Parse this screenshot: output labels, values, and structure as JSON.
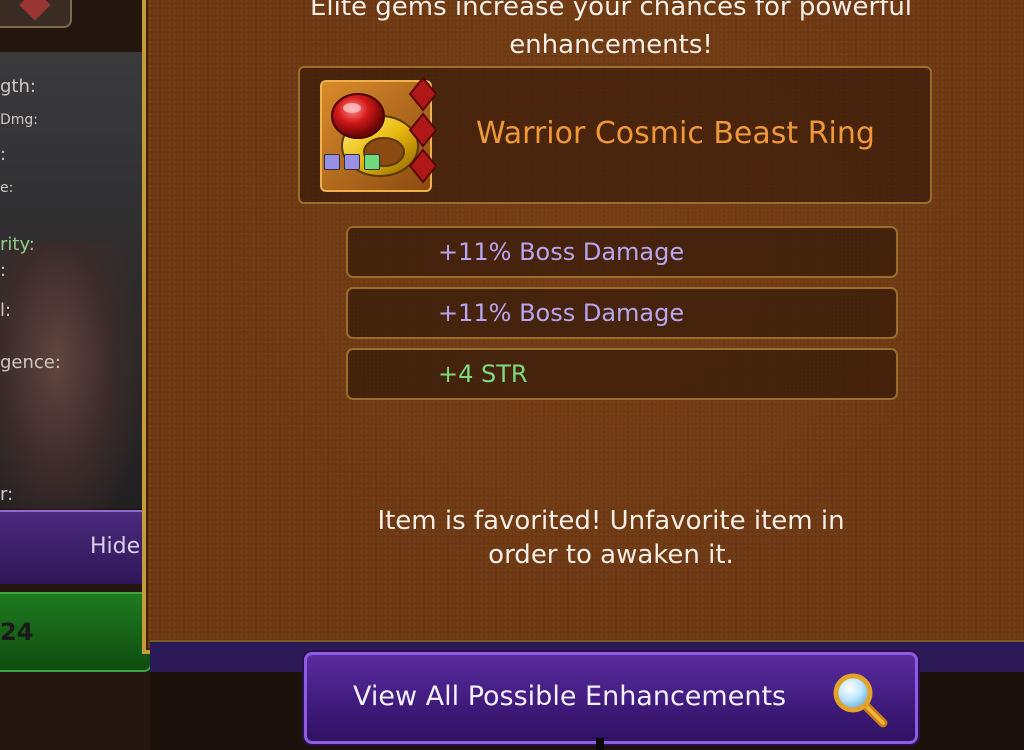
{
  "left_panel": {
    "stat_labels": [
      "gth:",
      "Dmg:",
      ":",
      "e:",
      "rity:",
      ":",
      "l:",
      "gence:",
      "r:"
    ],
    "hide_button_label": "Hide",
    "green_button_value": "24"
  },
  "modal": {
    "header_line1": "Elite gems increase your chances for powerful",
    "header_line2": "enhancements!",
    "item": {
      "name": "Warrior Cosmic Beast Ring",
      "gem_colors": [
        "#9a8fe6",
        "#9a8fe6",
        "#6fd97c"
      ]
    },
    "enhancements": [
      {
        "text": "+11% Boss Damage",
        "color": "purple"
      },
      {
        "text": "+11% Boss Damage",
        "color": "purple"
      },
      {
        "text": "+4 STR",
        "color": "green"
      }
    ],
    "favorited_line1": "Item is favorited! Unfavorite item in",
    "favorited_line2": "order to awaken it."
  },
  "footer": {
    "view_button_label": "View All Possible Enhancements"
  },
  "colors": {
    "item_name": "#f0973a",
    "enh_purple": "#b8a6f0",
    "enh_green": "#7cdc7e",
    "modal_bg": "#6f3a14",
    "button_purple": "#4a2290"
  },
  "icons": [
    "heart-favorite-icon",
    "magnifier-icon",
    "ring-item-icon"
  ]
}
